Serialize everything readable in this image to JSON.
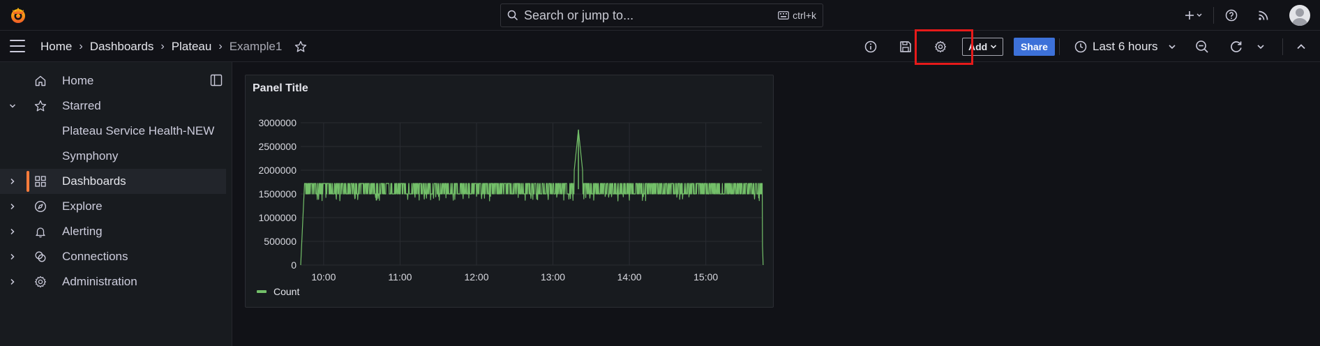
{
  "topbar": {
    "search_placeholder": "Search or jump to...",
    "shortcut": "ctrl+k",
    "icons": [
      "grafana-logo-icon",
      "plus-icon",
      "help-icon",
      "rss-icon",
      "avatar"
    ]
  },
  "breadcrumb": {
    "items": [
      "Home",
      "Dashboards",
      "Plateau",
      "Example1"
    ]
  },
  "toolbar": {
    "add_label": "Add",
    "share_label": "Share",
    "time_range": "Last 6 hours"
  },
  "sidebar": {
    "items": [
      {
        "label": "Home",
        "icon": "home-icon"
      },
      {
        "label": "Starred",
        "icon": "star-icon"
      },
      {
        "label": "Plateau Service Health-NEW"
      },
      {
        "label": "Symphony"
      },
      {
        "label": "Dashboards",
        "icon": "apps-icon"
      },
      {
        "label": "Explore",
        "icon": "compass-icon"
      },
      {
        "label": "Alerting",
        "icon": "bell-icon"
      },
      {
        "label": "Connections",
        "icon": "connections-icon"
      },
      {
        "label": "Administration",
        "icon": "cog-icon"
      }
    ]
  },
  "colors": {
    "background": "#111217",
    "panel": "#181b1f",
    "series": "#73bf69",
    "accent": "#ff7c3b",
    "share": "#3d71d9",
    "highlight": "#e61a1a"
  },
  "panel": {
    "title": "Panel Title"
  },
  "chart_data": {
    "type": "line",
    "title": "Panel Title",
    "x_ticks": [
      "10:00",
      "11:00",
      "12:00",
      "13:00",
      "14:00",
      "15:00"
    ],
    "y_ticks": [
      "0",
      "500000",
      "1000000",
      "1500000",
      "2000000",
      "2500000",
      "3000000"
    ],
    "ylim": [
      0,
      3000000
    ],
    "grid": true,
    "legend_position": "bottom-left",
    "series": [
      {
        "name": "Count",
        "color": "#73bf69",
        "x": [
          "09:45",
          "10:00",
          "10:15",
          "10:30",
          "10:45",
          "11:00",
          "11:15",
          "11:30",
          "11:40",
          "11:45",
          "12:00",
          "12:15",
          "12:30",
          "12:45",
          "13:00",
          "13:15",
          "13:20",
          "13:25",
          "13:30",
          "13:45",
          "14:00",
          "14:15",
          "14:30",
          "14:45",
          "15:00",
          "15:15",
          "15:30",
          "15:43",
          "15:45"
        ],
        "y": [
          1550000,
          1600000,
          1450000,
          1620000,
          1500000,
          1600000,
          1470000,
          1650000,
          1800000,
          1550000,
          1600000,
          1450000,
          1620000,
          1500000,
          1600000,
          1550000,
          2850000,
          1550000,
          1600000,
          1480000,
          1620000,
          1500000,
          1600000,
          1470000,
          1620000,
          1500000,
          1600000,
          1600000,
          0
        ]
      }
    ]
  }
}
